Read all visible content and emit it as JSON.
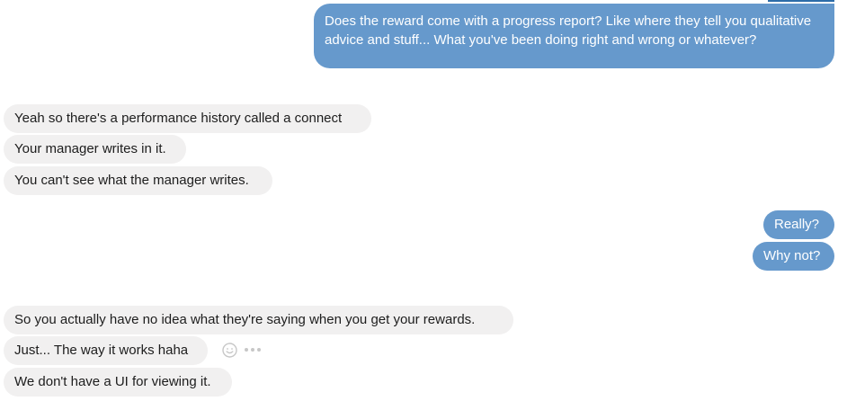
{
  "conversation": {
    "messages": [
      {
        "sender": "me",
        "text": "Does the reward come with a progress report? Like where they tell you qualitative advice and stuff... What you've been doing right and wrong or whatever?"
      },
      {
        "sender": "them",
        "text": "Yeah so there's a performance history called a connect"
      },
      {
        "sender": "them",
        "text": "Your manager writes in it."
      },
      {
        "sender": "them",
        "text": "You can't see what the manager writes."
      },
      {
        "sender": "me",
        "text": "Really?"
      },
      {
        "sender": "me",
        "text": "Why not?"
      },
      {
        "sender": "them",
        "text": "So you actually have no idea what they're saying when you get your rewards."
      },
      {
        "sender": "them",
        "text": "Just... The way it works haha"
      },
      {
        "sender": "them",
        "text": "We don't have a UI for viewing it."
      }
    ]
  },
  "message_actions": {
    "icons": [
      "smiley-icon",
      "more-icon"
    ]
  },
  "colors": {
    "outgoing_bubble": "#6699cc",
    "incoming_bubble": "#f1f0f0",
    "outgoing_text": "#ffffff",
    "incoming_text": "#1d1d1d"
  }
}
